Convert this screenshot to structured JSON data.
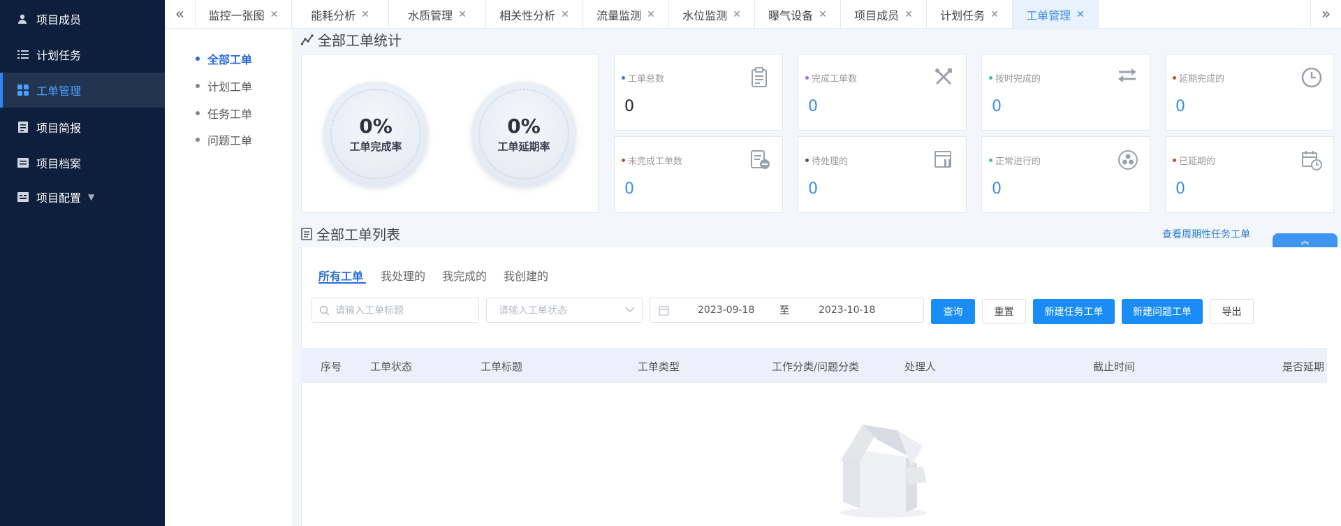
{
  "sidebar": {
    "items": [
      {
        "label": "项目成员"
      },
      {
        "label": "计划任务"
      },
      {
        "label": "工单管理"
      },
      {
        "label": "项目简报"
      },
      {
        "label": "项目档案"
      },
      {
        "label": "项目配置"
      }
    ]
  },
  "tabs": [
    {
      "label": "监控一张图"
    },
    {
      "label": "能耗分析"
    },
    {
      "label": "水质管理"
    },
    {
      "label": "相关性分析"
    },
    {
      "label": "流量监测"
    },
    {
      "label": "水位监测"
    },
    {
      "label": "曝气设备"
    },
    {
      "label": "项目成员"
    },
    {
      "label": "计划任务"
    },
    {
      "label": "工单管理"
    }
  ],
  "subnav": {
    "items": [
      {
        "label": "全部工单"
      },
      {
        "label": "计划工单"
      },
      {
        "label": "任务工单"
      },
      {
        "label": "问题工单"
      }
    ]
  },
  "stats": {
    "title": "全部工单统计",
    "completion_rate": {
      "value": "0%",
      "label": "工单完成率"
    },
    "delay_rate": {
      "value": "0%",
      "label": "工单延期率"
    },
    "cards": [
      {
        "label": "工单总数",
        "value": "0",
        "dot": "#3a7bd5",
        "icon": "clipboard-icon"
      },
      {
        "label": "完成工单数",
        "value": "0",
        "dot": "#9b6ef0",
        "icon": "tools-icon"
      },
      {
        "label": "按时完成的",
        "value": "0",
        "dot": "#3cc0a0",
        "icon": "transfer-icon"
      },
      {
        "label": "延期完成的",
        "value": "0",
        "dot": "#d9481c",
        "icon": "clock-icon"
      },
      {
        "label": "未完成工单数",
        "value": "0",
        "dot": "#d9481c",
        "icon": "doc-minus-icon"
      },
      {
        "label": "待处理的",
        "value": "0",
        "dot": "#555555",
        "icon": "pending-icon"
      },
      {
        "label": "正常进行的",
        "value": "0",
        "dot": "#3cc0a0",
        "icon": "fan-icon"
      },
      {
        "label": "已延期的",
        "value": "0",
        "dot": "#d9481c",
        "icon": "calendar-clock-icon"
      }
    ]
  },
  "list": {
    "title": "全部工单列表",
    "periodic_link": "查看周期性任务工单",
    "tabs": [
      {
        "label": "所有工单"
      },
      {
        "label": "我处理的"
      },
      {
        "label": "我完成的"
      },
      {
        "label": "我创建的"
      }
    ],
    "search_placeholder": "请输入工单标题",
    "status_placeholder": "请输入工单状态",
    "date_start": "2023-09-18",
    "date_sep": "至",
    "date_end": "2023-10-18",
    "buttons": {
      "query": "查询",
      "reset": "重置",
      "new_task": "新建任务工单",
      "new_issue": "新建问题工单",
      "export": "导出"
    },
    "columns": [
      "序号",
      "工单状态",
      "工单标题",
      "工单类型",
      "工作分类/问题分类",
      "处理人",
      "截止时间",
      "是否延期"
    ]
  },
  "colors": {
    "sidebar_bg": "#0d1f3c",
    "accent": "#1a8cf5"
  }
}
